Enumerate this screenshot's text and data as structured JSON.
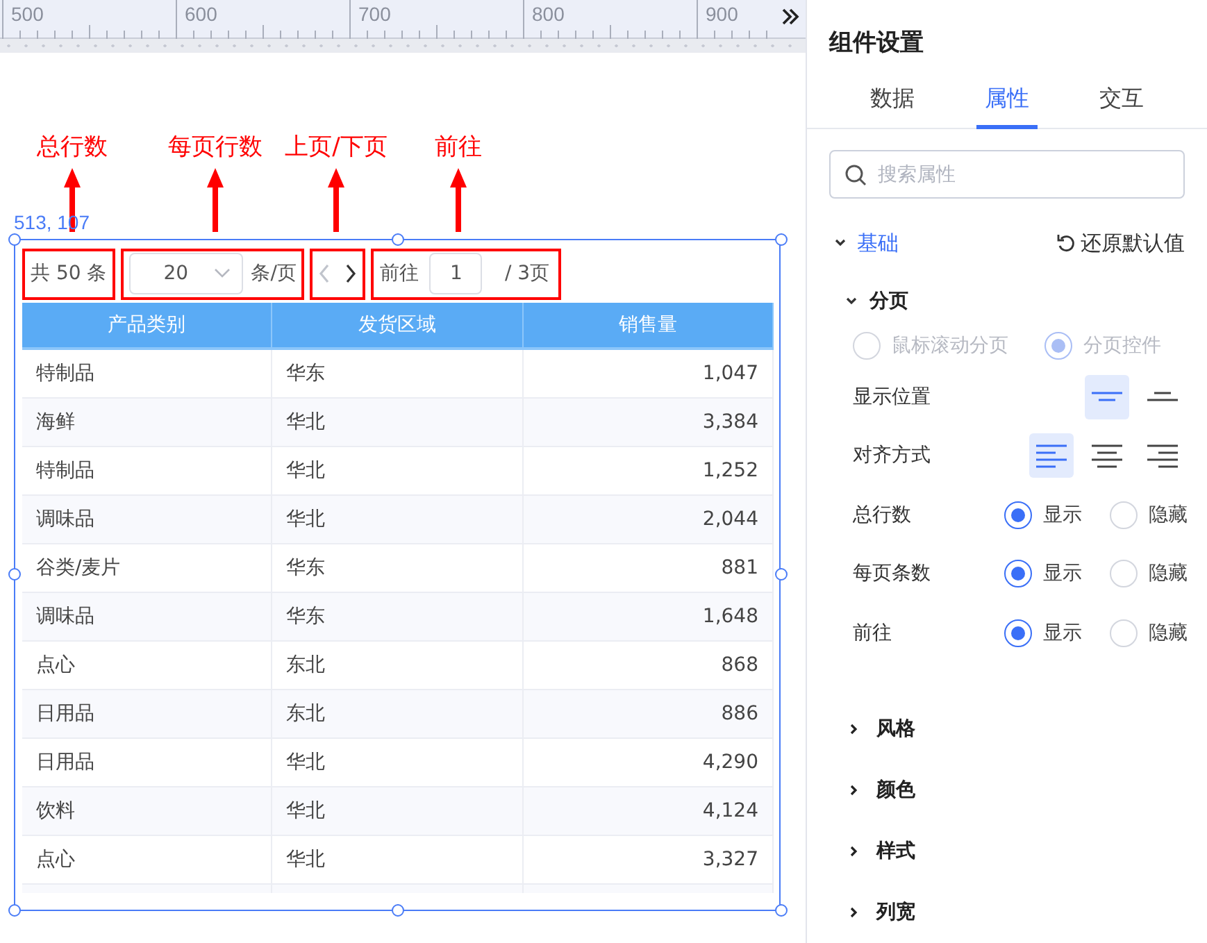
{
  "ruler": {
    "labels": [
      "500",
      "600",
      "700",
      "800",
      "900"
    ]
  },
  "annotations": [
    {
      "label": "总行数"
    },
    {
      "label": "每页行数"
    },
    {
      "label": "上页/下页"
    },
    {
      "label": "前往"
    }
  ],
  "widget": {
    "coordinates": "513, 107",
    "pagination": {
      "total": "共 50 条",
      "page_size": "20",
      "page_size_unit": "条/页",
      "prev": {
        "disabled": true
      },
      "next": {
        "disabled": false
      },
      "goto_label": "前往",
      "goto_value": "1",
      "page_count": "/ 3页"
    },
    "table": {
      "columns": [
        {
          "label": "产品类别",
          "kind": "text"
        },
        {
          "label": "发货区域",
          "kind": "text"
        },
        {
          "label": "销售量",
          "kind": "number"
        }
      ],
      "rows": [
        [
          "特制品",
          "华东",
          "1,047"
        ],
        [
          "海鲜",
          "华北",
          "3,384"
        ],
        [
          "特制品",
          "华北",
          "1,252"
        ],
        [
          "调味品",
          "华北",
          "2,044"
        ],
        [
          "谷类/麦片",
          "华东",
          "881"
        ],
        [
          "调味品",
          "华东",
          "1,648"
        ],
        [
          "点心",
          "东北",
          "868"
        ],
        [
          "日用品",
          "东北",
          "886"
        ],
        [
          "日用品",
          "华北",
          "4,290"
        ],
        [
          "饮料",
          "华北",
          "4,124"
        ],
        [
          "点心",
          "华北",
          "3,327"
        ]
      ]
    }
  },
  "panel": {
    "title": "组件设置",
    "tabs": [
      {
        "label": "数据",
        "selected": false
      },
      {
        "label": "属性",
        "selected": true
      },
      {
        "label": "交互",
        "selected": false
      }
    ],
    "search": {
      "placeholder": "搜索属性"
    },
    "section": {
      "title": "基础",
      "expanded": true,
      "reset": "还原默认值",
      "subsection": {
        "title": "分页",
        "expanded": true,
        "mode": {
          "disabled": true,
          "options": [
            {
              "label": "鼠标滚动分页",
              "selected": false
            },
            {
              "label": "分页控件",
              "selected": true
            }
          ]
        },
        "settings": [
          {
            "kind": "icons",
            "label": "显示位置",
            "options": [
              {
                "kind": "top",
                "selected": true
              },
              {
                "kind": "bottom",
                "selected": false
              }
            ]
          },
          {
            "kind": "icons",
            "label": "对齐方式",
            "options": [
              {
                "kind": "left",
                "selected": true
              },
              {
                "kind": "center",
                "selected": false
              },
              {
                "kind": "right",
                "selected": false
              }
            ]
          },
          {
            "kind": "radio",
            "label": "总行数",
            "options": [
              {
                "label": "显示",
                "selected": true
              },
              {
                "label": "隐藏",
                "selected": false
              }
            ]
          },
          {
            "kind": "radio",
            "label": "每页条数",
            "options": [
              {
                "label": "显示",
                "selected": true
              },
              {
                "label": "隐藏",
                "selected": false
              }
            ]
          },
          {
            "kind": "radio",
            "label": "前往",
            "options": [
              {
                "label": "显示",
                "selected": true
              },
              {
                "label": "隐藏",
                "selected": false
              }
            ]
          }
        ]
      }
    },
    "groups": [
      {
        "title": "风格",
        "expanded": false
      },
      {
        "title": "颜色",
        "expanded": false
      },
      {
        "title": "样式",
        "expanded": false
      },
      {
        "title": "列宽",
        "expanded": false
      }
    ]
  }
}
